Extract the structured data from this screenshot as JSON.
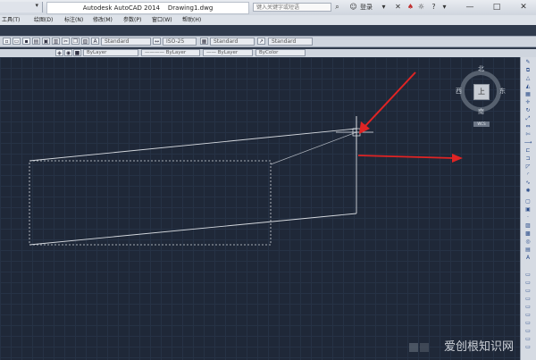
{
  "window": {
    "app_title": "Autodesk AutoCAD 2014",
    "file_name": "Drawing1.dwg",
    "search_placeholder": "键入关键字或短语",
    "login_label": "登录",
    "minimize": "—",
    "maximize": "□",
    "close": "✕"
  },
  "menu": {
    "items": [
      "工具(T)",
      "绘图(D)",
      "标注(N)",
      "修改(M)",
      "参数(P)",
      "窗口(W)",
      "帮助(H)"
    ]
  },
  "styles_toolbar": {
    "text_style": "Standard",
    "dim_style": "ISO-25",
    "table_style": "Standard",
    "multileader_style": "Standard"
  },
  "properties_toolbar": {
    "layer_color": "ByLayer",
    "linetype": "ByLayer",
    "lineweight": "ByLayer",
    "plot_style": "ByColor"
  },
  "viewcube": {
    "north": "北",
    "south": "南",
    "east": "东",
    "west": "西",
    "face": "上",
    "wcs": "WCS"
  },
  "watermark": {
    "text": "爱创根知识网"
  },
  "colors": {
    "canvas_bg": "#1f2838",
    "line": "#d4d8de",
    "arrow": "#e02424"
  }
}
